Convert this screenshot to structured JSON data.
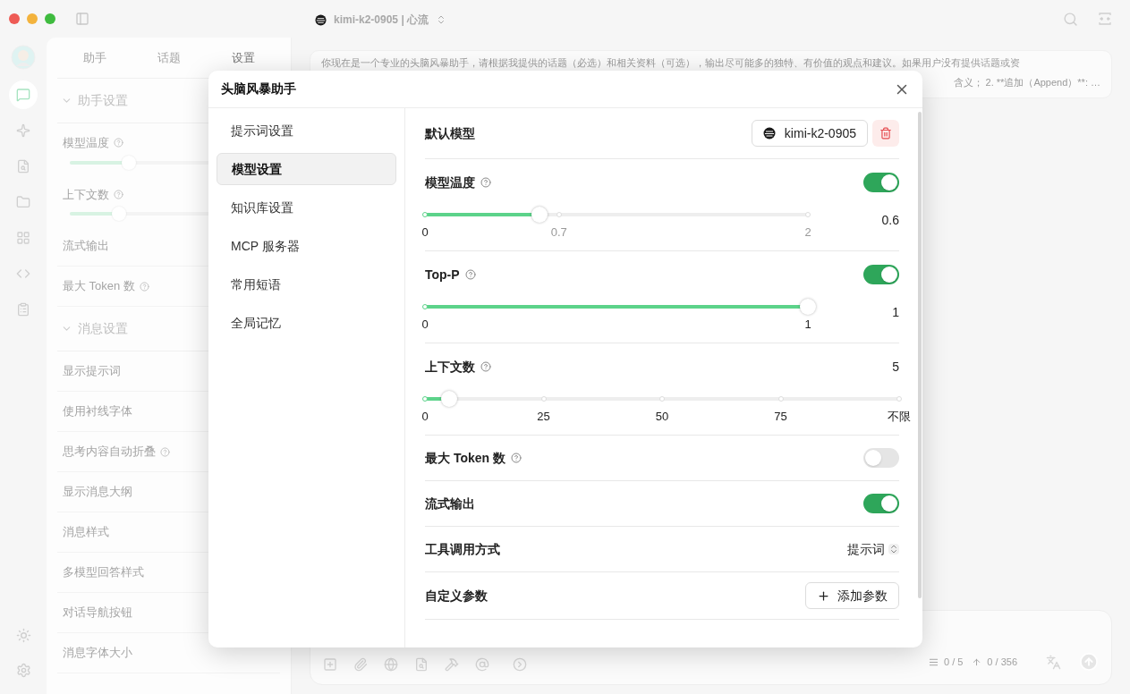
{
  "titlebar": {
    "title": "kimi-k2-0905 | 心流"
  },
  "rail": {
    "items": [
      {
        "kind": "avatar",
        "selected": false
      },
      {
        "kind": "chat",
        "selected": true
      },
      {
        "kind": "sparkle",
        "selected": false
      },
      {
        "kind": "file",
        "selected": false
      },
      {
        "kind": "folder",
        "selected": false
      },
      {
        "kind": "grid",
        "selected": false
      },
      {
        "kind": "code",
        "selected": false
      },
      {
        "kind": "notes",
        "selected": false
      }
    ]
  },
  "side_panel": {
    "tabs": [
      {
        "label": "助手",
        "selected": false
      },
      {
        "label": "话题",
        "selected": false
      },
      {
        "label": "设置",
        "selected": true
      }
    ],
    "sections": [
      {
        "title": "助手设置",
        "expanded": true,
        "items": [
          {
            "kind": "slider",
            "label": "模型温度",
            "help": true,
            "level": 0.3
          },
          {
            "kind": "slider",
            "label": "上下文数",
            "help": true,
            "level": 0.25
          },
          {
            "kind": "plain",
            "label": "流式输出",
            "help": false
          },
          {
            "kind": "plain",
            "label": "最大 Token 数",
            "help": true
          }
        ]
      },
      {
        "title": "消息设置",
        "expanded": true,
        "items": [
          {
            "kind": "plain",
            "label": "显示提示词",
            "help": false
          },
          {
            "kind": "plain",
            "label": "使用衬线字体",
            "help": false
          },
          {
            "kind": "plain",
            "label": "思考内容自动折叠",
            "help": true
          },
          {
            "kind": "plain",
            "label": "显示消息大纲",
            "help": false
          },
          {
            "kind": "plain",
            "label": "消息样式",
            "help": false
          },
          {
            "kind": "plain",
            "label": "多模型回答样式",
            "help": false
          },
          {
            "kind": "plain",
            "label": "对话导航按钮",
            "help": false
          },
          {
            "kind": "plain",
            "label": "消息字体大小",
            "help": false
          }
        ]
      }
    ]
  },
  "prompt_preview": {
    "lines": [
      "你现在是一个专业的头脑风暴助手，请根据我提供的话题（必选）和相关资料（可选），输出尽可能多的独特、有价值的观点和建议。如果用户没有提供话题或资",
      "含义； 2. **追加（Append）**: …"
    ]
  },
  "composer": {
    "counts": [
      "0 / 5",
      "0 / 356"
    ]
  },
  "dialog": {
    "title": "头脑风暴助手",
    "nav": [
      {
        "label": "提示词设置",
        "selected": false
      },
      {
        "label": "模型设置",
        "selected": true
      },
      {
        "label": "知识库设置",
        "selected": false
      },
      {
        "label": "MCP 服务器",
        "selected": false
      },
      {
        "label": "常用短语",
        "selected": false
      },
      {
        "label": "全局记忆",
        "selected": false
      }
    ],
    "rows": [
      {
        "kind": "model",
        "label": "默认模型",
        "model": "kimi-k2-0905"
      },
      {
        "kind": "slider",
        "label": "模型温度",
        "help": true,
        "on": true,
        "level": 0.3,
        "value": "0.6",
        "marks": [
          {
            "label": "0",
            "level": 0
          },
          {
            "label": "0.7",
            "level": 0.35
          },
          {
            "label": "2",
            "level": 1
          }
        ]
      },
      {
        "kind": "slider",
        "label": "Top-P",
        "help": true,
        "on": true,
        "level": 1,
        "value": "1",
        "marks": [
          {
            "label": "0",
            "level": 0
          },
          {
            "label": "1",
            "level": 1
          }
        ]
      },
      {
        "kind": "steps",
        "label": "上下文数",
        "help": true,
        "value": "5",
        "level": 0.05,
        "marks": [
          {
            "label": "0",
            "level": 0
          },
          {
            "label": "25",
            "level": 0.25
          },
          {
            "label": "50",
            "level": 0.5
          },
          {
            "label": "75",
            "level": 0.75
          },
          {
            "label": "不限",
            "level": 1
          }
        ]
      },
      {
        "kind": "toggle",
        "label": "最大 Token 数",
        "help": true,
        "on": false
      },
      {
        "kind": "toggle",
        "label": "流式输出",
        "help": false,
        "on": true
      },
      {
        "kind": "select",
        "label": "工具调用方式",
        "value": "提示词"
      },
      {
        "kind": "button",
        "label": "自定义参数",
        "button": "添加参数"
      }
    ]
  }
}
